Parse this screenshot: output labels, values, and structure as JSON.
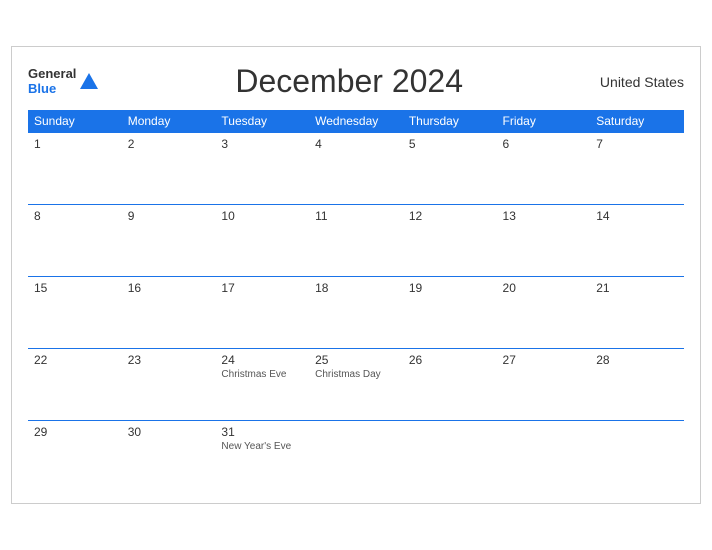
{
  "header": {
    "title": "December 2024",
    "country": "United States",
    "logo_general": "General",
    "logo_blue": "Blue"
  },
  "weekdays": [
    "Sunday",
    "Monday",
    "Tuesday",
    "Wednesday",
    "Thursday",
    "Friday",
    "Saturday"
  ],
  "weeks": [
    [
      {
        "day": "1",
        "holiday": ""
      },
      {
        "day": "2",
        "holiday": ""
      },
      {
        "day": "3",
        "holiday": ""
      },
      {
        "day": "4",
        "holiday": ""
      },
      {
        "day": "5",
        "holiday": ""
      },
      {
        "day": "6",
        "holiday": ""
      },
      {
        "day": "7",
        "holiday": ""
      }
    ],
    [
      {
        "day": "8",
        "holiday": ""
      },
      {
        "day": "9",
        "holiday": ""
      },
      {
        "day": "10",
        "holiday": ""
      },
      {
        "day": "11",
        "holiday": ""
      },
      {
        "day": "12",
        "holiday": ""
      },
      {
        "day": "13",
        "holiday": ""
      },
      {
        "day": "14",
        "holiday": ""
      }
    ],
    [
      {
        "day": "15",
        "holiday": ""
      },
      {
        "day": "16",
        "holiday": ""
      },
      {
        "day": "17",
        "holiday": ""
      },
      {
        "day": "18",
        "holiday": ""
      },
      {
        "day": "19",
        "holiday": ""
      },
      {
        "day": "20",
        "holiday": ""
      },
      {
        "day": "21",
        "holiday": ""
      }
    ],
    [
      {
        "day": "22",
        "holiday": ""
      },
      {
        "day": "23",
        "holiday": ""
      },
      {
        "day": "24",
        "holiday": "Christmas Eve"
      },
      {
        "day": "25",
        "holiday": "Christmas Day"
      },
      {
        "day": "26",
        "holiday": ""
      },
      {
        "day": "27",
        "holiday": ""
      },
      {
        "day": "28",
        "holiday": ""
      }
    ],
    [
      {
        "day": "29",
        "holiday": ""
      },
      {
        "day": "30",
        "holiday": ""
      },
      {
        "day": "31",
        "holiday": "New Year's Eve"
      },
      {
        "day": "",
        "holiday": ""
      },
      {
        "day": "",
        "holiday": ""
      },
      {
        "day": "",
        "holiday": ""
      },
      {
        "day": "",
        "holiday": ""
      }
    ]
  ]
}
